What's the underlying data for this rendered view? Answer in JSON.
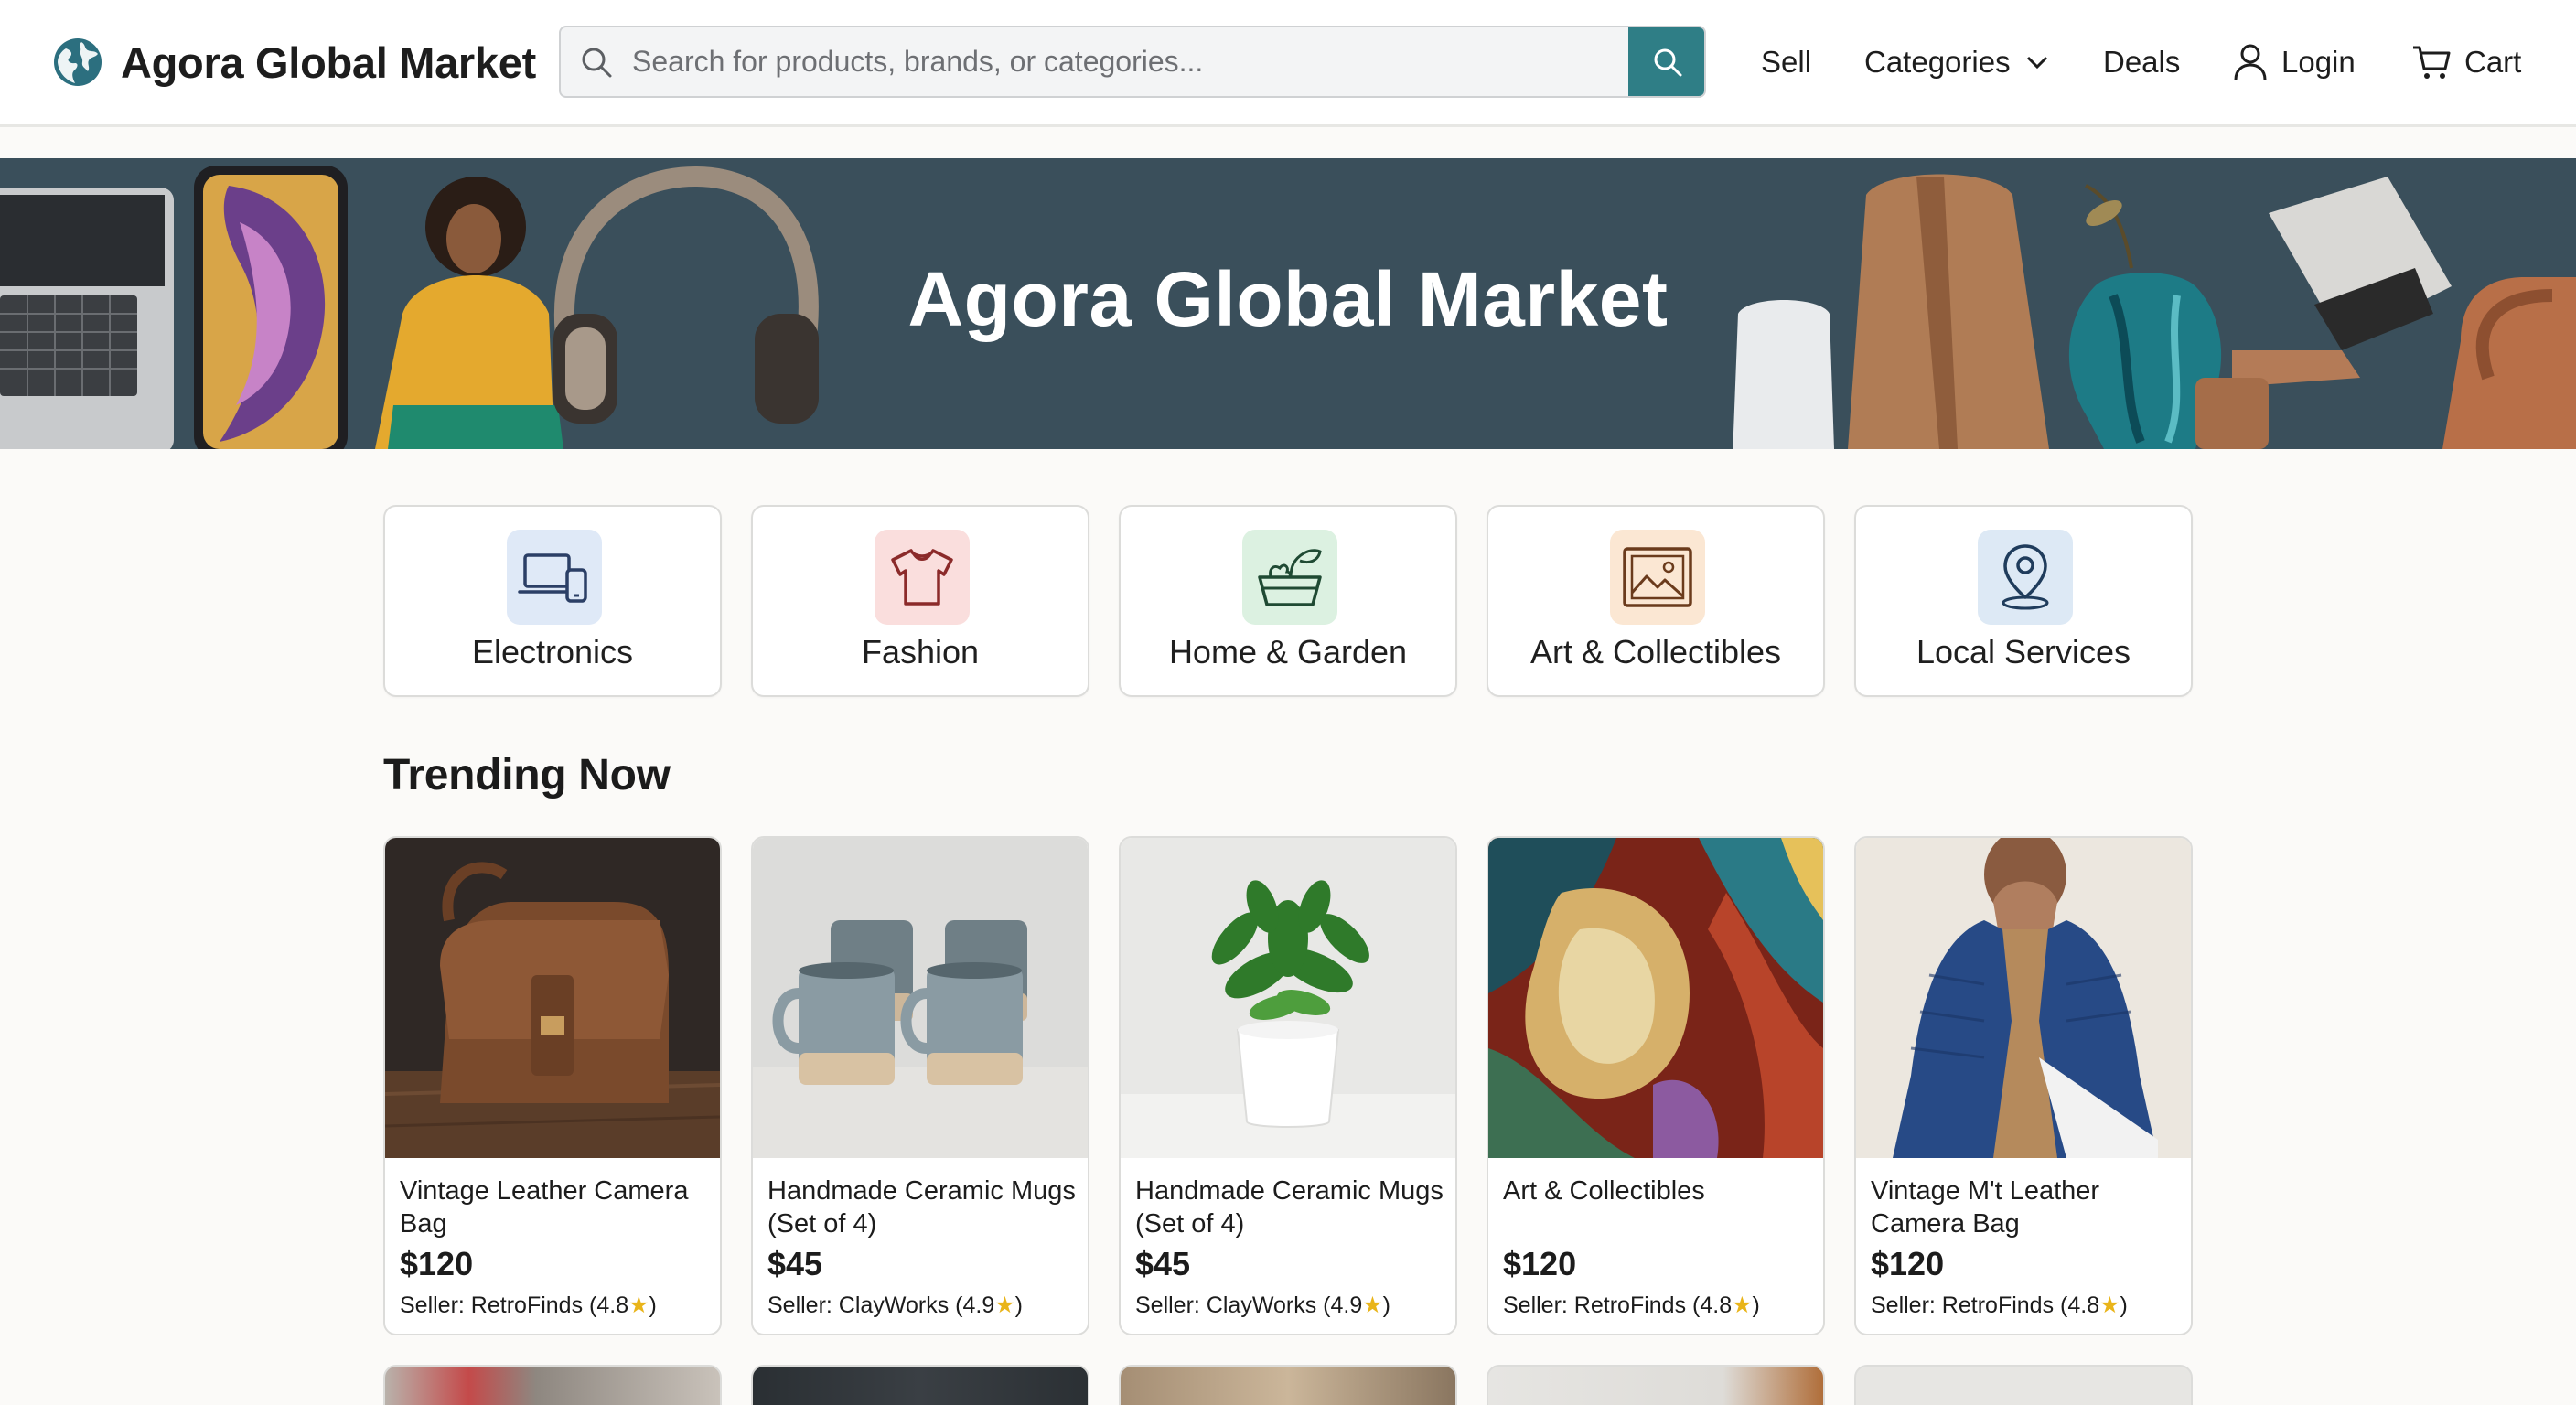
{
  "header": {
    "logo_text": "Agora Global Market",
    "search_placeholder": "Search for products, brands, or categories...",
    "nav": {
      "sell": "Sell",
      "categories": "Categories",
      "deals": "Deals",
      "login": "Login",
      "cart": "Cart"
    }
  },
  "hero": {
    "title": "Agora Global Market"
  },
  "categories": [
    {
      "label": "Electronics",
      "icon": "laptop-phone-icon",
      "tint": "#dfe9f7"
    },
    {
      "label": "Fashion",
      "icon": "tshirt-icon",
      "tint": "#fadedd"
    },
    {
      "label": "Home & Garden",
      "icon": "planter-icon",
      "tint": "#dcf1e1"
    },
    {
      "label": "Art & Collectibles",
      "icon": "picture-icon",
      "tint": "#fbe7d3"
    },
    {
      "label": "Local Services",
      "icon": "map-pin-icon",
      "tint": "#dde9f5"
    }
  ],
  "trending": {
    "title": "Trending Now",
    "products": [
      {
        "title": "Vintage Leather Camera Bag",
        "price": "$120",
        "seller": "Seller: RetroFinds (4.8",
        "star": "★",
        "close": ")"
      },
      {
        "title": "Handmade Ceramic Mugs (Set of 4)",
        "price": "$45",
        "seller": "Seller: ClayWorks (4.9",
        "star": "★",
        "close": ")"
      },
      {
        "title": "Handmade Ceramic Mugs (Set of 4)",
        "price": "$45",
        "seller": "Seller: ClayWorks (4.9",
        "star": "★",
        "close": ")"
      },
      {
        "title": "Art & Collectibles",
        "price": "$120",
        "seller": "Seller: RetroFinds (4.8",
        "star": "★",
        "close": ")"
      },
      {
        "title": "Vintage M't Leather Camera Bag",
        "price": "$120",
        "seller": "Seller: RetroFinds (4.8",
        "star": "★",
        "close": ")"
      }
    ]
  },
  "colors": {
    "accent": "#2f7e86",
    "hero_bg": "#3a4f5b",
    "star": "#e9b419"
  }
}
